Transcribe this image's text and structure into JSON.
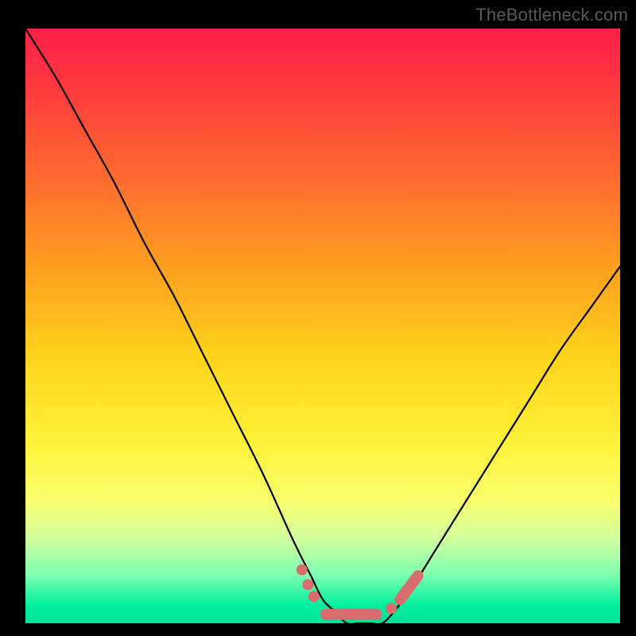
{
  "watermark": "TheBottleneck.com",
  "colors": {
    "gradient_top": "#ff1f4a",
    "gradient_bottom": "#00e39a",
    "curve": "#000000",
    "markers": "#d86d6d"
  },
  "chart_data": {
    "type": "line",
    "title": "",
    "xlabel": "",
    "ylabel": "",
    "xlim": [
      0,
      100
    ],
    "ylim": [
      0,
      100
    ],
    "grid": false,
    "series": [
      {
        "name": "bottleneck-curve",
        "x": [
          0,
          5,
          10,
          15,
          20,
          25,
          30,
          35,
          40,
          45,
          48,
          50,
          52,
          54,
          56,
          58,
          60,
          62,
          65,
          70,
          75,
          80,
          85,
          90,
          95,
          100
        ],
        "y": [
          100,
          92,
          83,
          74,
          64,
          55,
          45,
          35,
          25,
          14,
          8,
          4,
          2,
          0,
          0,
          0,
          0,
          2,
          6,
          14,
          22,
          30,
          38,
          46,
          53,
          60
        ]
      }
    ],
    "markers": [
      {
        "shape": "circle",
        "x": 46.5,
        "y": 9.0
      },
      {
        "shape": "circle",
        "x": 47.5,
        "y": 6.5
      },
      {
        "shape": "circle",
        "x": 48.5,
        "y": 4.5
      },
      {
        "shape": "capsule",
        "x0": 50.5,
        "y0": 1.5,
        "x1": 59.0,
        "y1": 1.5
      },
      {
        "shape": "circle",
        "x": 61.5,
        "y": 2.5
      },
      {
        "shape": "capsule",
        "x0": 63.0,
        "y0": 4.0,
        "x1": 66.0,
        "y1": 8.0
      }
    ]
  }
}
